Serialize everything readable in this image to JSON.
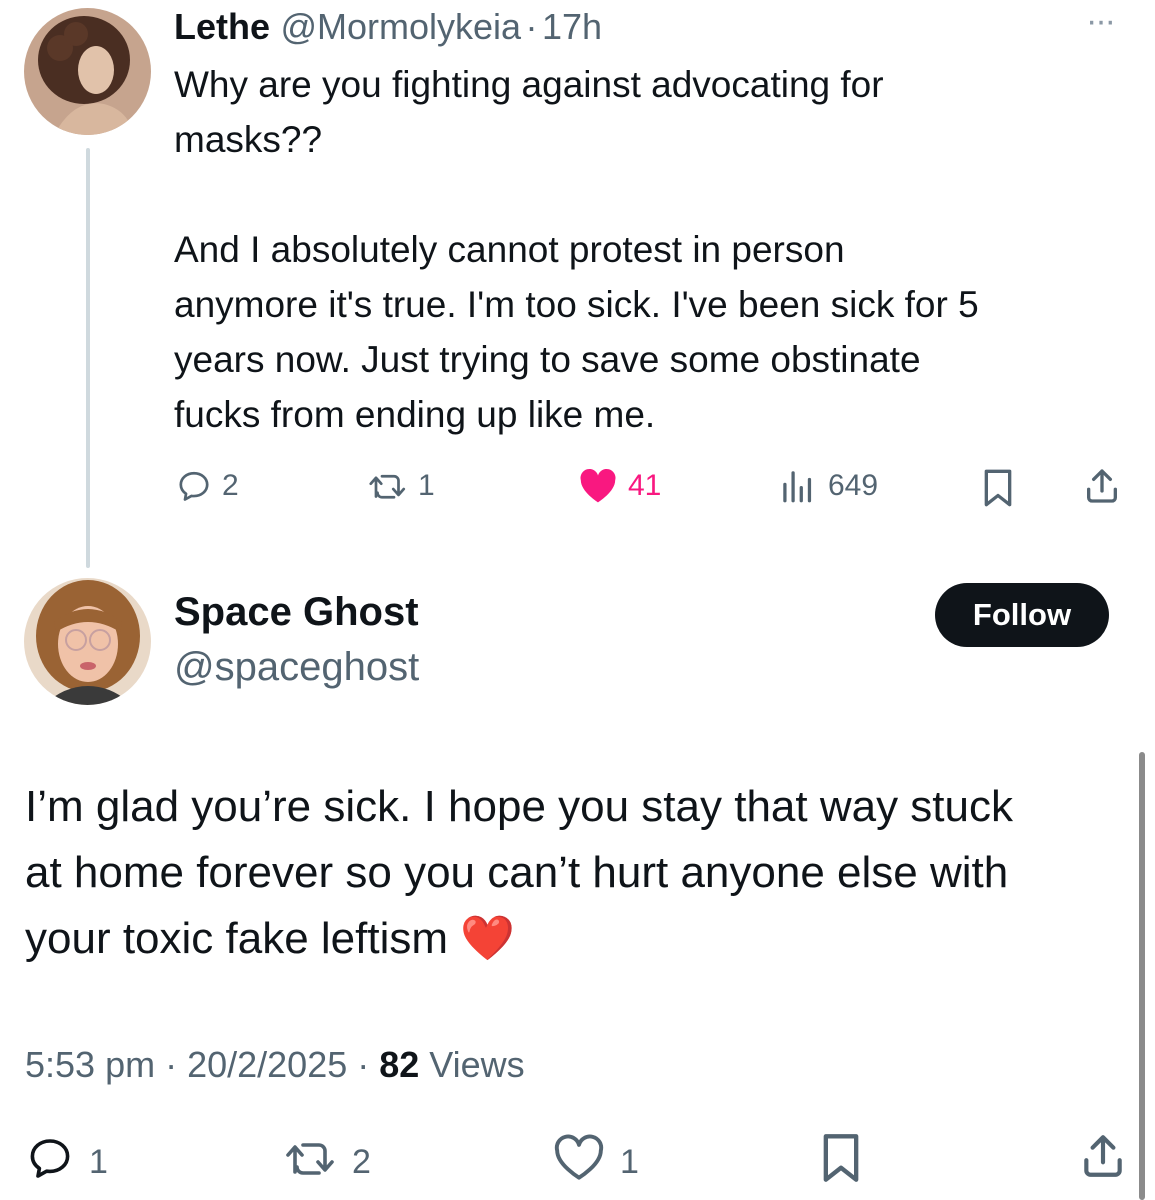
{
  "reply_tweet": {
    "display_name": "Lethe",
    "handle": "@Mormolykeia",
    "separator": "·",
    "time": "17h",
    "more_label": "···",
    "text": "Why are you fighting against advocating for\nmasks??\n\nAnd I absolutely cannot protest in person\nanymore it's true. I'm too sick. I've been sick for 5\nyears now. Just trying to save some obstinate\nfucks from ending up like me.",
    "replies": "2",
    "reposts": "1",
    "likes": "41",
    "views": "649",
    "like_color": "#f91880"
  },
  "main_tweet": {
    "display_name": "Space Ghost",
    "handle": "@spaceghost",
    "follow_label": "Follow",
    "text": "I’m glad you’re sick. I hope you stay that way stuck\nat home forever so you can’t hurt anyone else with\nyour toxic fake leftism ",
    "emoji": "❤️",
    "time": "5:53 pm",
    "sep1": " · ",
    "date": "20/2/2025",
    "sep2": " · ",
    "views_count": "82",
    "views_label": " Views",
    "replies": "1",
    "reposts": "2",
    "likes": "1"
  },
  "icons": [
    "more-icon",
    "reply-icon",
    "repost-icon",
    "like-icon",
    "views-icon",
    "bookmark-icon",
    "share-icon"
  ]
}
